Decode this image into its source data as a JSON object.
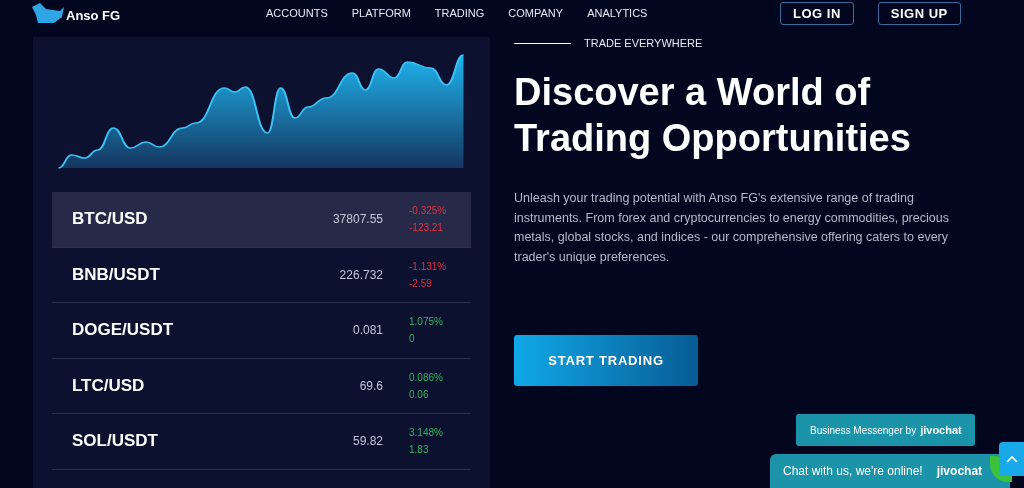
{
  "brand": {
    "name": "Anso FG"
  },
  "nav": [
    "ACCOUNTS",
    "PLATFORM",
    "TRADING",
    "COMPANY",
    "ANALYTICS"
  ],
  "auth_buttons": [
    "LOG IN",
    "SIGN UP"
  ],
  "markets": [
    {
      "symbol": "BTC/USD",
      "price": "37807.55",
      "change_pct": "-0.325%",
      "change": "-123.21",
      "kind": "down",
      "selected": true
    },
    {
      "symbol": "BNB/USDT",
      "price": "226.732",
      "change_pct": "-1.131%",
      "change": "-2.59",
      "kind": "down",
      "selected": false
    },
    {
      "symbol": "DOGE/USDT",
      "price": "0.081",
      "change_pct": "1.075%",
      "change": "0",
      "kind": "up",
      "selected": false
    },
    {
      "symbol": "LTC/USD",
      "price": "69.6",
      "change_pct": "0.086%",
      "change": "0.06",
      "kind": "up",
      "selected": false
    },
    {
      "symbol": "SOL/USDT",
      "price": "59.82",
      "change_pct": "3.148%",
      "change": "1.83",
      "kind": "up",
      "selected": false
    }
  ],
  "hero": {
    "eyebrow": "TRADE EVERYWHERE",
    "title": "Discover a World of Trading Opportunities",
    "body": "Unleash your trading potential with Anso FG's extensive range of trading instruments. From forex and cryptocurrencies to energy commodities, precious metals, global stocks, and indices - our comprehensive offering caters to every trader's unique preferences.",
    "cta": "START TRADING"
  },
  "chat": {
    "tooltip": "Business Messenger by",
    "tooltip_brand": "jivochat",
    "label": "Chat with us, we're online!",
    "brand": "jivochat"
  }
}
